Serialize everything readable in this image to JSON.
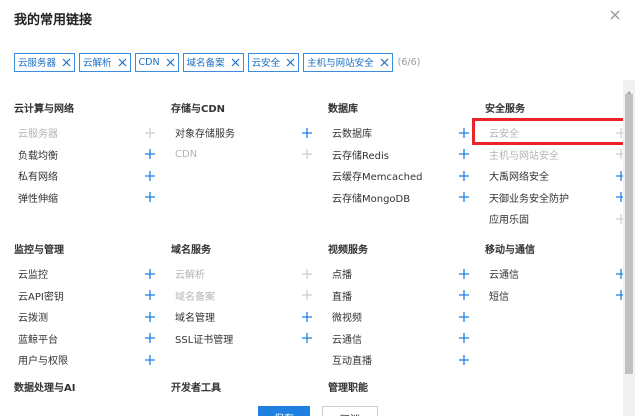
{
  "dialog": {
    "title": "我的常用链接",
    "close_icon": "close-icon"
  },
  "selected": {
    "chips": [
      {
        "label": "云服务器"
      },
      {
        "label": "云解析"
      },
      {
        "label": "CDN"
      },
      {
        "label": "域名备案"
      },
      {
        "label": "云安全"
      },
      {
        "label": "主机与网站安全"
      }
    ],
    "count": "(6/6)"
  },
  "sections": {
    "compute_network": {
      "title": "云计算与网络",
      "items": [
        {
          "label": "云服务器",
          "disabled": true
        },
        {
          "label": "负载均衡",
          "disabled": false
        },
        {
          "label": "私有网络",
          "disabled": false
        },
        {
          "label": "弹性伸缩",
          "disabled": false
        }
      ]
    },
    "storage_cdn": {
      "title": "存储与CDN",
      "items": [
        {
          "label": "对象存储服务",
          "disabled": false
        },
        {
          "label": "CDN",
          "disabled": true
        }
      ]
    },
    "database": {
      "title": "数据库",
      "items": [
        {
          "label": "云数据库",
          "disabled": false
        },
        {
          "label": "云存储Redis",
          "disabled": false
        },
        {
          "label": "云缓存Memcached",
          "disabled": false
        },
        {
          "label": "云存储MongoDB",
          "disabled": false
        }
      ]
    },
    "security": {
      "title": "安全服务",
      "items": [
        {
          "label": "云安全",
          "disabled": true
        },
        {
          "label": "主机与网站安全",
          "disabled": true
        },
        {
          "label": "大禹网络安全",
          "disabled": false
        },
        {
          "label": "天御业务安全防护",
          "disabled": false
        },
        {
          "label": "应用乐固",
          "disabled": false
        }
      ]
    },
    "monitor_manage": {
      "title": "监控与管理",
      "items": [
        {
          "label": "云监控",
          "disabled": false
        },
        {
          "label": "云API密钥",
          "disabled": false
        },
        {
          "label": "云拨测",
          "disabled": false
        },
        {
          "label": "蓝鲸平台",
          "disabled": false
        },
        {
          "label": "用户与权限",
          "disabled": false
        }
      ]
    },
    "domain": {
      "title": "域名服务",
      "items": [
        {
          "label": "云解析",
          "disabled": true
        },
        {
          "label": "域名备案",
          "disabled": true
        },
        {
          "label": "域名管理",
          "disabled": false
        },
        {
          "label": "SSL证书管理",
          "disabled": false
        }
      ]
    },
    "video": {
      "title": "视频服务",
      "items": [
        {
          "label": "点播",
          "disabled": false
        },
        {
          "label": "直播",
          "disabled": false
        },
        {
          "label": "微视频",
          "disabled": false
        },
        {
          "label": "云通信",
          "disabled": false
        },
        {
          "label": "互动直播",
          "disabled": false
        }
      ]
    },
    "mobile_comm": {
      "title": "移动与通信",
      "items": [
        {
          "label": "云通信",
          "disabled": false
        },
        {
          "label": "短信",
          "disabled": false
        }
      ]
    },
    "cut_titles": {
      "data_ai": "数据处理与AI",
      "dev_tools": "开发者工具",
      "mgmt": "管理职能"
    }
  },
  "footer": {
    "save_label": "保存",
    "cancel_label": "取消"
  },
  "colors": {
    "accent": "#1f80e0",
    "chip_border": "#3c8dde",
    "highlight": "#e8252a",
    "disabled_text": "#b4b4b4"
  }
}
